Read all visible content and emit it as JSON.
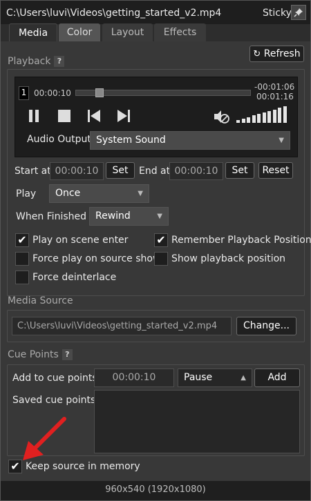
{
  "window": {
    "title": "C:\\Users\\luvi\\Videos\\getting_started_v2.mp4",
    "sticky_label": "Sticky",
    "pin_icon": "pin-icon"
  },
  "tabs": [
    {
      "label": "Media",
      "active": true
    },
    {
      "label": "Color",
      "active": false
    },
    {
      "label": "Layout",
      "active": false
    },
    {
      "label": "Effects",
      "active": false
    }
  ],
  "playback": {
    "section_label": "Playback",
    "help": "?",
    "refresh_label": "Refresh",
    "refresh_icon": "refresh-icon",
    "track_number": "1",
    "current_time": "00:00:10",
    "remaining_time": "-00:01:06",
    "total_time": "00:01:16",
    "progress_fraction": 0.13,
    "volume_bars_total": 10,
    "volume_bars_filled": 10,
    "audio_output_label": "Audio Output",
    "audio_output_value": "System Sound",
    "start_at_label": "Start at",
    "start_at_value": "00:00:10",
    "start_set_label": "Set",
    "end_at_label": "End at",
    "end_at_value": "00:00:10",
    "end_set_label": "Set",
    "reset_label": "Reset",
    "play_label": "Play",
    "play_value": "Once",
    "when_finished_label": "When Finished",
    "when_finished_value": "Rewind",
    "checkboxes": {
      "play_on_scene_enter": {
        "label": "Play on scene enter",
        "checked": true
      },
      "remember_playback_position": {
        "label": "Remember Playback Position",
        "checked": true
      },
      "force_play_on_source_show": {
        "label": "Force play on source show",
        "checked": false
      },
      "show_playback_position": {
        "label": "Show playback position",
        "checked": false
      },
      "force_deinterlace": {
        "label": "Force deinterlace",
        "checked": false
      }
    }
  },
  "media_source": {
    "section_label": "Media Source",
    "path": "C:\\Users\\luvi\\Videos\\getting_started_v2.mp4",
    "change_label": "Change..."
  },
  "cue_points": {
    "section_label": "Cue Points",
    "help": "?",
    "add_label": "Add to cue points",
    "time_value": "00:00:10",
    "action_value": "Pause",
    "add_button": "Add",
    "saved_label": "Saved cue points"
  },
  "keep_in_memory": {
    "label": "Keep source in memory",
    "checked": true
  },
  "status_bar": "960x540 (1920x1080)",
  "colors": {
    "accent_red": "#e02020"
  }
}
